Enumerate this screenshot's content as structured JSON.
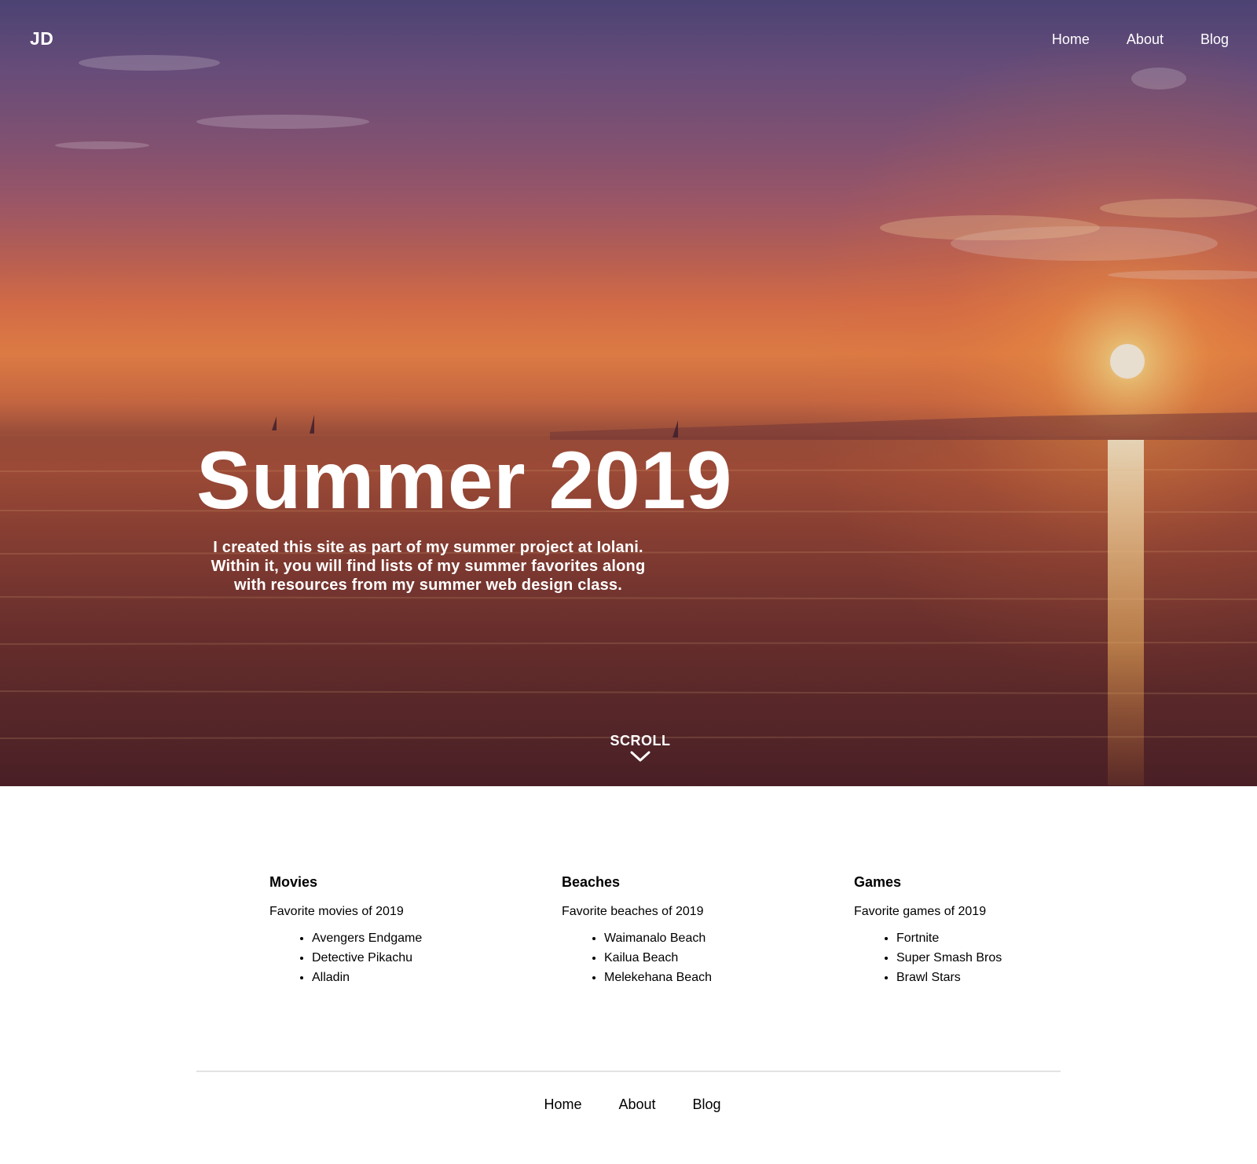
{
  "header": {
    "logo": "JD",
    "nav": [
      {
        "label": "Home"
      },
      {
        "label": "About"
      },
      {
        "label": "Blog"
      }
    ]
  },
  "hero": {
    "title": "Summer 2019",
    "description": "I created this site as part of my summer project at Iolani. Within it, you will find lists of my summer favorites along with resources from my summer web design class.",
    "scroll_label": "SCROLL",
    "scroll_icon": "chevron-down-icon",
    "background": "sunset-over-ocean-photo"
  },
  "sections": [
    {
      "title": "Movies",
      "subtitle": "Favorite movies of 2019",
      "items": [
        "Avengers Endgame",
        "Detective Pikachu",
        "Alladin"
      ]
    },
    {
      "title": "Beaches",
      "subtitle": "Favorite beaches of 2019",
      "items": [
        "Waimanalo Beach",
        "Kailua Beach",
        "Melekehana Beach"
      ]
    },
    {
      "title": "Games",
      "subtitle": "Favorite games of 2019",
      "items": [
        "Fortnite",
        "Super Smash Bros",
        "Brawl Stars"
      ]
    }
  ],
  "footer": {
    "nav": [
      {
        "label": "Home"
      },
      {
        "label": "About"
      },
      {
        "label": "Blog"
      }
    ]
  },
  "colors": {
    "text_on_hero": "#ffffff",
    "body_text": "#000000",
    "divider": "#e3e3e3",
    "sky_top": "#4e4a7e",
    "horizon_orange": "#f38a48",
    "sea_dark": "#5e2c28"
  }
}
